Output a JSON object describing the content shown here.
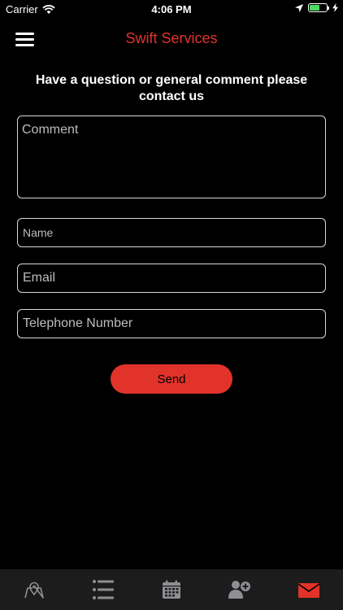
{
  "status_bar": {
    "carrier": "Carrier",
    "time": "4:06 PM",
    "battery_level": 0.55
  },
  "navbar": {
    "title": "Swift Services",
    "menu_icon": "hamburger-menu-icon"
  },
  "form": {
    "heading": "Have a question or general comment please contact us",
    "comment_placeholder": "Comment",
    "name_placeholder": "Name",
    "email_placeholder": "Email",
    "phone_placeholder": "Telephone Number",
    "send_label": "Send"
  },
  "tabbar": {
    "tabs": [
      {
        "icon": "map-pin-icon",
        "selected": false
      },
      {
        "icon": "list-icon",
        "selected": false
      },
      {
        "icon": "calendar-icon",
        "selected": false
      },
      {
        "icon": "add-person-icon",
        "selected": false
      },
      {
        "icon": "envelope-icon",
        "selected": true
      }
    ]
  },
  "colors": {
    "accent": "#e1332a",
    "background": "#000000",
    "tab_inactive": "#8e8e93",
    "tab_bar": "#1c1c1c"
  }
}
